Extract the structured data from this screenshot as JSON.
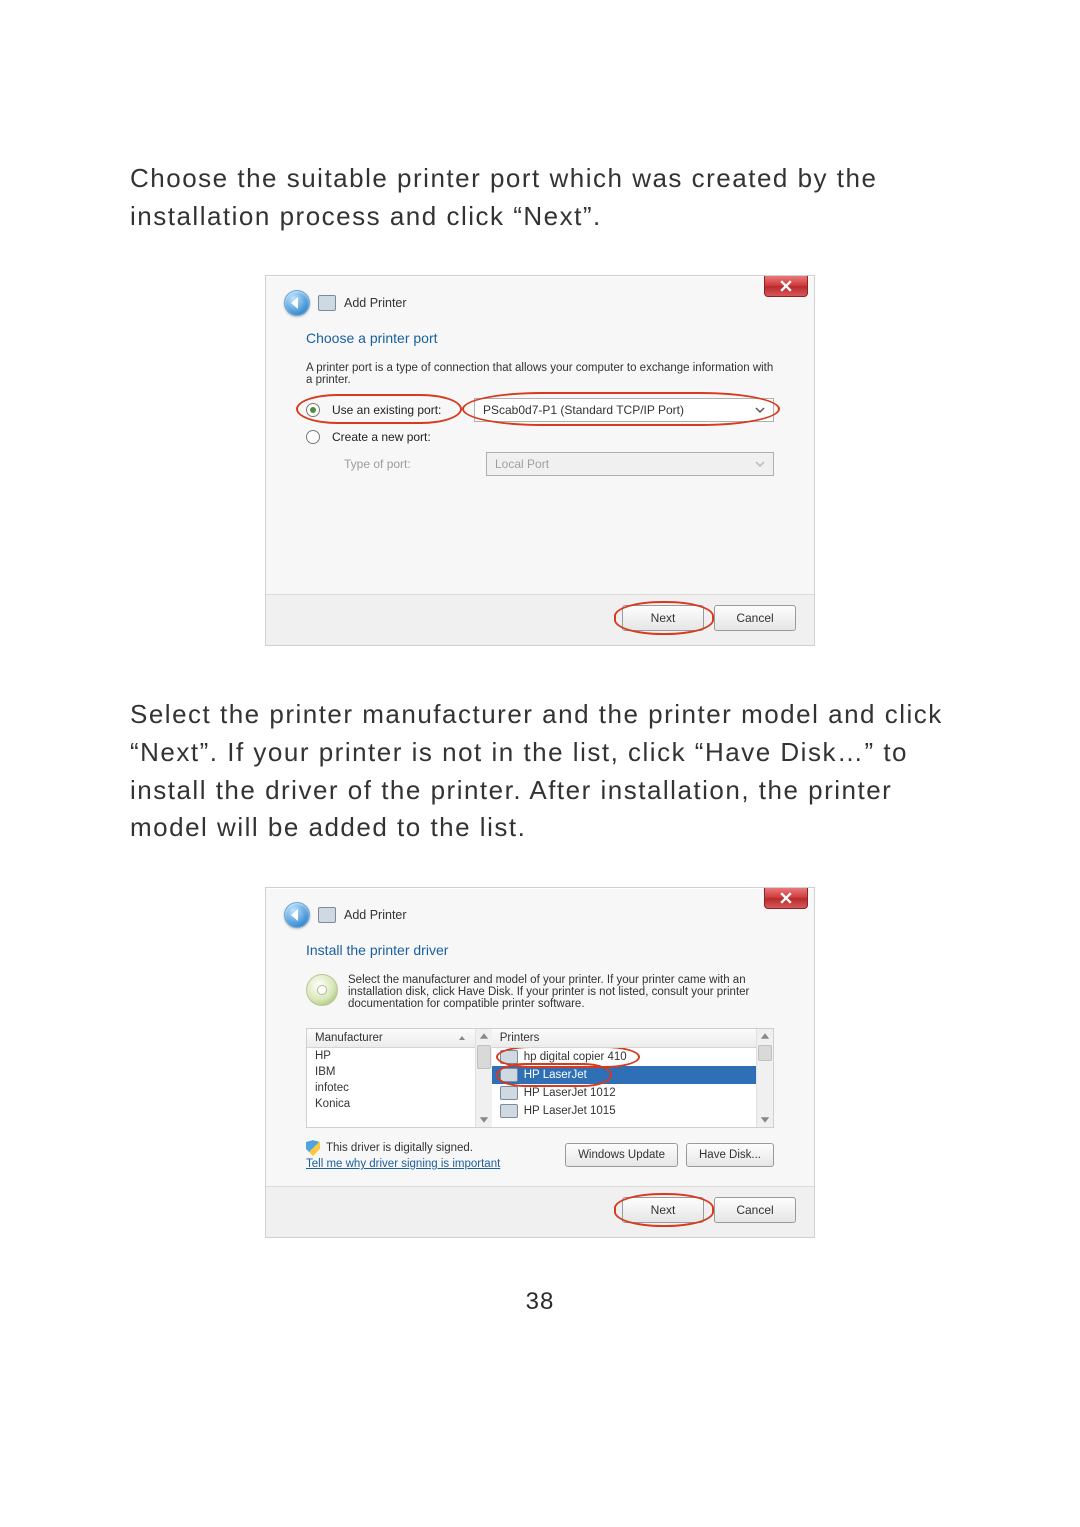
{
  "paragraph1": "Choose the suitable printer port which was created by the installation process and click “Next”.",
  "paragraph2": "Select the printer manufacturer and the printer model and click “Next”. If your printer is not in the list, click “Have Disk…” to install the driver of the printer. After installation, the printer model will be added to the list.",
  "page_number": "38",
  "dialog1": {
    "title": "Add Printer",
    "heading": "Choose a printer port",
    "helper": "A printer port is a type of connection that allows your computer to exchange information with a printer.",
    "opt_existing": "Use an existing port:",
    "opt_create": "Create a new port:",
    "type_of_port_label": "Type of port:",
    "port_value": "PScab0d7-P1 (Standard TCP/IP Port)",
    "type_value": "Local Port",
    "next": "Next",
    "cancel": "Cancel"
  },
  "dialog2": {
    "title": "Add Printer",
    "heading": "Install the printer driver",
    "helper": "Select the manufacturer and model of your printer. If your printer came with an installation disk, click Have Disk. If your printer is not listed, consult your printer documentation for compatible printer software.",
    "col_manufacturer": "Manufacturer",
    "col_printers": "Printers",
    "manufacturers": [
      "HP",
      "IBM",
      "infotec",
      "Konica"
    ],
    "printers": [
      "hp digital copier 410",
      "HP LaserJet",
      "HP LaserJet 1012",
      "HP LaserJet 1015"
    ],
    "signed": "This driver is digitally signed.",
    "why_link": "Tell me why driver signing is important",
    "win_update": "Windows Update",
    "have_disk": "Have Disk...",
    "next": "Next",
    "cancel": "Cancel"
  }
}
